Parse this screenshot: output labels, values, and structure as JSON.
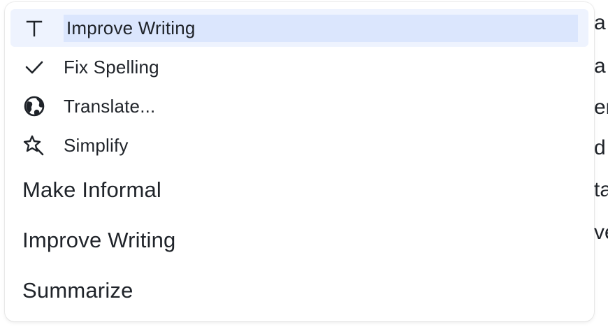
{
  "background": {
    "lines": [
      "a",
      "a",
      "er",
      "d",
      "ta",
      "ve"
    ]
  },
  "menu": {
    "items": [
      {
        "label": "Improve Writing",
        "icon": "text-t-icon"
      },
      {
        "label": "Fix Spelling",
        "icon": "check-icon"
      },
      {
        "label": "Translate...",
        "icon": "globe-icon"
      },
      {
        "label": "Simplify",
        "icon": "magic-star-icon"
      },
      {
        "label": "Make Informal"
      },
      {
        "label": "Improve Writing"
      },
      {
        "label": "Summarize"
      }
    ],
    "highlight_color": "#dbe6fd"
  }
}
